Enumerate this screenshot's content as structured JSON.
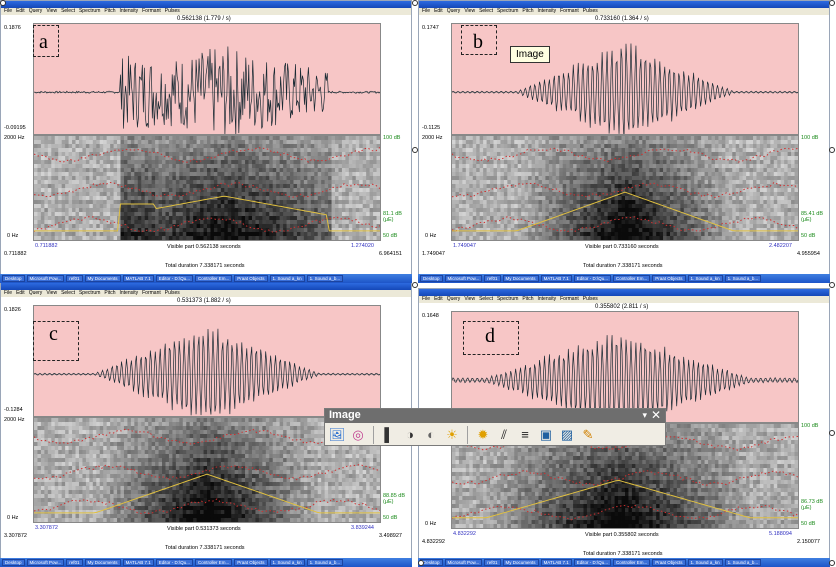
{
  "menu": [
    "File",
    "Edit",
    "Query",
    "View",
    "Select",
    "Spectrum",
    "Pitch",
    "Intensity",
    "Formant",
    "Pulses"
  ],
  "tooltip": "Image",
  "toolbar": {
    "title": "Image",
    "icons": [
      "insert-picture-icon",
      "color-icon",
      "contrast-more-icon",
      "contrast-less-icon",
      "brightness-more-icon",
      "brightness-less-icon",
      "crop-icon",
      "line-style-icon",
      "compress-icon",
      "format-picture-icon",
      "set-transparent-color-icon",
      "reset-picture-icon"
    ]
  },
  "panels": [
    {
      "letter": "a",
      "cursor": "0.562138 (1.779 / s)",
      "y_top": "0.1876",
      "y_bot": "-0.09195",
      "freq_top": "2000 Hz",
      "freq_bot": "0 Hz",
      "db_top": "100 dB",
      "db_mid": "81.1 dB (μE)",
      "db_bot": "50 dB",
      "vis_start": "0.711882",
      "vis_end": "1.274020",
      "visible": "Visible part 0.562138 seconds",
      "win_start": "0.711882",
      "win_end": "6.964151",
      "total": "Total duration 7.338171 seconds"
    },
    {
      "letter": "b",
      "cursor": "0.733160 (1.364 / s)",
      "y_top": "0.1747",
      "y_bot": "-0.1125",
      "freq_top": "2000 Hz",
      "freq_bot": "0 Hz",
      "db_top": "100 dB",
      "db_mid": "85.41 dB (μE)",
      "db_bot": "50 dB",
      "vis_start": "1.749047",
      "vis_end": "2.482207",
      "visible": "Visible part 0.733160 seconds",
      "win_start": "1.749047",
      "win_end": "4.955954",
      "total": "Total duration 7.338171 seconds"
    },
    {
      "letter": "c",
      "cursor": "0.531373 (1.882 / s)",
      "y_top": "0.1826",
      "y_bot": "-0.1284",
      "freq_top": "2000 Hz",
      "freq_bot": "0 Hz",
      "db_top": "100 dB",
      "db_mid": "88.85 dB (μE)",
      "db_bot": "50 dB",
      "vis_start": "3.307872",
      "vis_end": "3.839244",
      "visible": "Visible part 0.531373 seconds",
      "win_start": "3.307872",
      "win_end": "3.498927",
      "total": "Total duration 7.338171 seconds"
    },
    {
      "letter": "d",
      "cursor": "0.355802 (2.811 / s)",
      "y_top": "0.1648",
      "y_bot": "-0.1",
      "freq_top": "2000 Hz",
      "freq_bot": "0 Hz",
      "db_top": "100 dB",
      "db_mid": "86.73 dB (μE)",
      "db_bot": "50 dB",
      "vis_start": "4.832292",
      "vis_end": "5.188094",
      "visible": "Visible part 0.355802 seconds",
      "win_start": "4.832292",
      "win_end": "2.150077",
      "total": "Total duration 7.338171 seconds"
    }
  ],
  "taskbar_items": [
    "Desktop",
    "Microsoft Pow...",
    "ref01",
    "My Documents",
    "MATLAB 7.1",
    "Editor - D:\\Qu...",
    "Controller Em...",
    "Praat Objects",
    "1. Sound a_kn",
    "1. Sound a_b..."
  ]
}
